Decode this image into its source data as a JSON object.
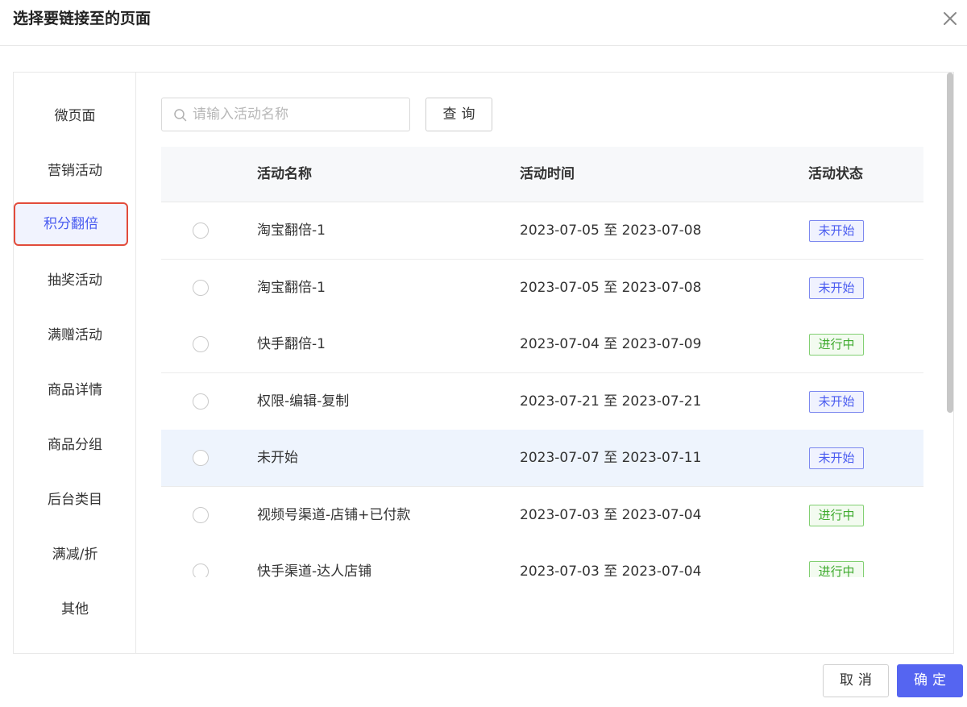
{
  "dialog": {
    "title": "选择要链接至的页面"
  },
  "sidebar": {
    "items": [
      {
        "label": "微页面"
      },
      {
        "label": "营销活动"
      },
      {
        "label": "积分翻倍"
      },
      {
        "label": "抽奖活动"
      },
      {
        "label": "满赠活动"
      },
      {
        "label": "商品详情"
      },
      {
        "label": "商品分组"
      },
      {
        "label": "后台类目"
      },
      {
        "label": "满减/折"
      },
      {
        "label": "其他"
      }
    ],
    "active_index": 2
  },
  "search": {
    "placeholder": "请输入活动名称",
    "value": "",
    "query_label": "查询"
  },
  "table": {
    "columns": [
      "活动名称",
      "活动时间",
      "活动状态"
    ],
    "rows": [
      {
        "name": "淘宝翻倍-1",
        "time": "2023-07-05 至 2023-07-08",
        "status": "未开始",
        "status_color": "blue"
      },
      {
        "name": "淘宝翻倍-1",
        "time": "2023-07-05 至 2023-07-08",
        "status": "未开始",
        "status_color": "blue"
      },
      {
        "name": "快手翻倍-1",
        "time": "2023-07-04 至 2023-07-09",
        "status": "进行中",
        "status_color": "green"
      },
      {
        "name": "权限-编辑-复制",
        "time": "2023-07-21 至 2023-07-21",
        "status": "未开始",
        "status_color": "blue"
      },
      {
        "name": "未开始",
        "time": "2023-07-07 至 2023-07-11",
        "status": "未开始",
        "status_color": "blue"
      },
      {
        "name": "视频号渠道-店铺+已付款",
        "time": "2023-07-03 至 2023-07-04",
        "status": "进行中",
        "status_color": "green"
      },
      {
        "name": "快手渠道-达人店铺",
        "time": "2023-07-03 至 2023-07-04",
        "status": "进行中",
        "status_color": "green"
      }
    ],
    "hovered_row": 4
  },
  "footer": {
    "cancel_label": "取消",
    "ok_label": "确定"
  },
  "colors": {
    "accent": "#5565f1",
    "highlight_border": "#e24b3b",
    "status_blue": "#4a5cf0",
    "status_green": "#3eaa2e"
  },
  "icons": {
    "close": "close-icon",
    "search": "search-icon"
  }
}
